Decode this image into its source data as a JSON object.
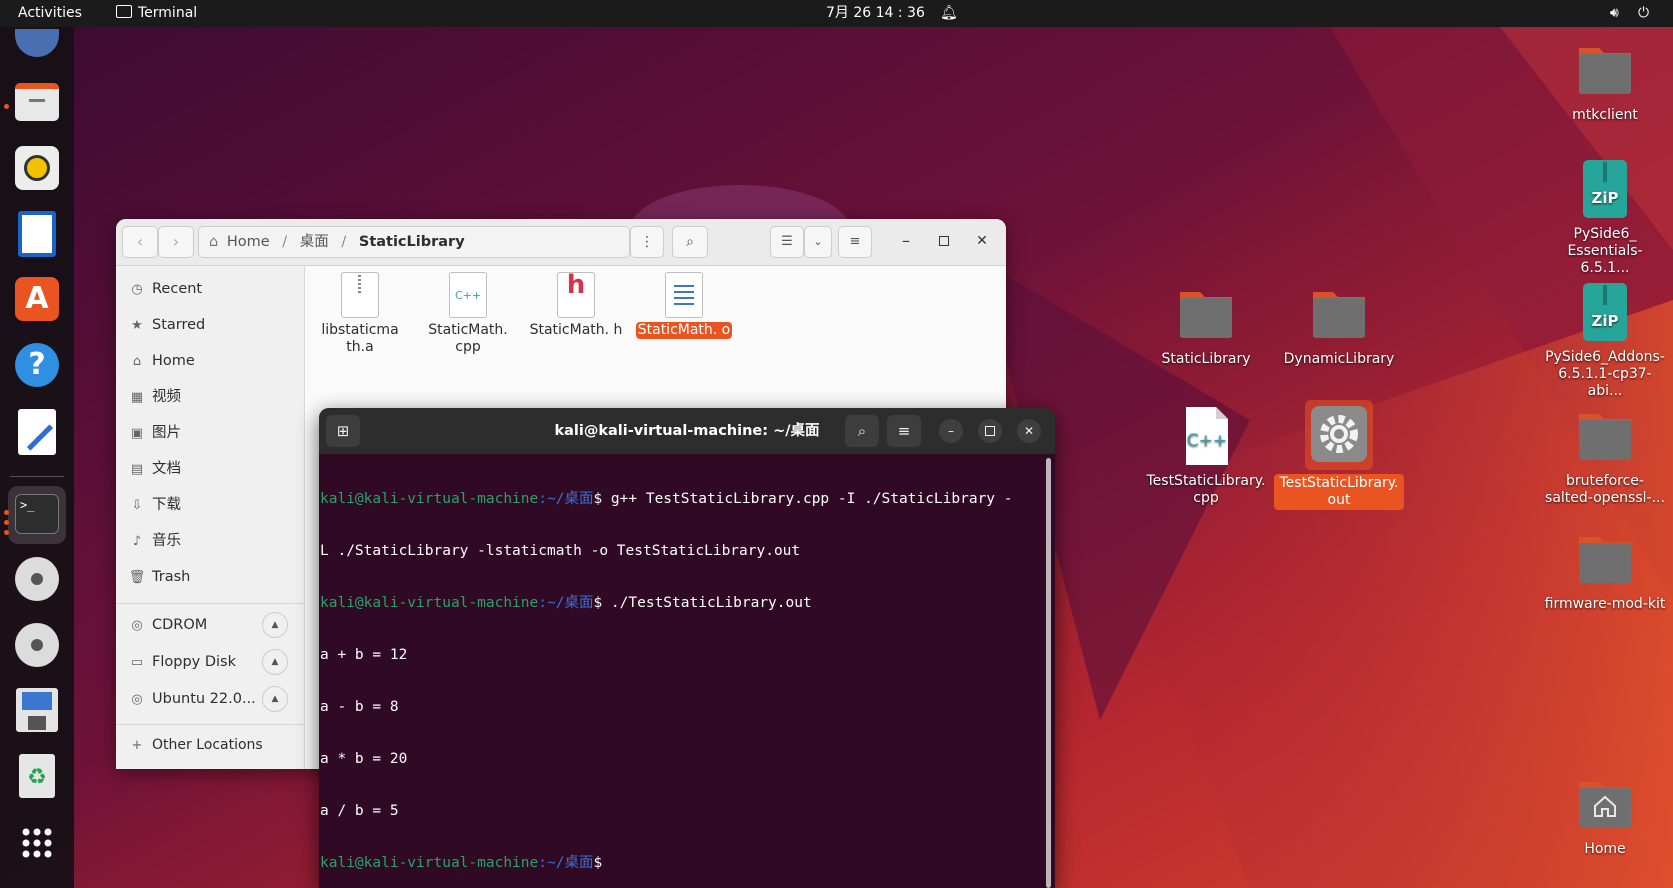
{
  "topbar": {
    "activities": "Activities",
    "app": "Terminal",
    "clock": "7月 26 14 : 36"
  },
  "desktop_icons": [
    {
      "label": "mtkclient"
    },
    {
      "label": "PySide6_ Essentials-6.5.1..."
    },
    {
      "label": "StaticLibrary"
    },
    {
      "label": "DynamicLibrary"
    },
    {
      "label": "PySide6_Addons-6.5.1.1-cp37-abi..."
    },
    {
      "label": "TestStaticLibrary. cpp"
    },
    {
      "label": "TestStaticLibrary. out"
    },
    {
      "label": "bruteforce- salted-openssl-..."
    },
    {
      "label": "firmware-mod-kit"
    },
    {
      "label": "Home"
    }
  ],
  "files": {
    "breadcrumb": [
      "Home",
      "桌面",
      "StaticLibrary"
    ],
    "sidebar": [
      "Recent",
      "Starred",
      "Home",
      "视频",
      "图片",
      "文档",
      "下载",
      "音乐",
      "Trash"
    ],
    "devices": [
      "CDROM",
      "Floppy Disk",
      "Ubuntu 22.0..."
    ],
    "other": "Other Locations",
    "items": [
      {
        "name": "libstaticma th.a",
        "badge": ""
      },
      {
        "name": "StaticMath. cpp",
        "badge": "C++"
      },
      {
        "name": "StaticMath. h",
        "badge": "h"
      },
      {
        "name": "StaticMath. o",
        "badge": ""
      }
    ]
  },
  "terminal": {
    "title": "kali@kali-virtual-machine: ~/桌面",
    "prompt_user": "kali@kali-virtual-machine",
    "prompt_path": ":~/桌面",
    "prompt_sign": "$",
    "cmd1_a": " g++ TestStaticLibrary.cpp -I ./StaticLibrary -",
    "cmd1_b": "L ./StaticLibrary -lstaticmath -o TestStaticLibrary.out",
    "cmd2": " ./TestStaticLibrary.out",
    "out": [
      "a + b = 12",
      "a - b = 8",
      "a * b = 20",
      "a / b = 5"
    ]
  },
  "colors": {
    "accent": "#e95420",
    "terminal_bg": "#300a24",
    "prompt_user": "#26a269",
    "prompt_path": "#3a6fd6"
  }
}
